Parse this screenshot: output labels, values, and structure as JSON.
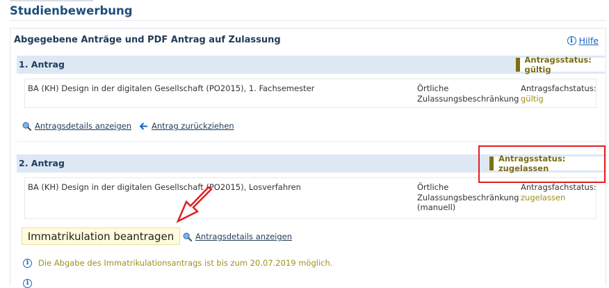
{
  "page": {
    "title": "Studienbewerbung"
  },
  "panel": {
    "title": "Abgegebene Anträge und PDF Antrag auf Zulassung",
    "help_label": "Hilfe"
  },
  "applications": [
    {
      "header": "1. Antrag",
      "status": "Antragsstatus: gültig",
      "course": "BA (KH) Design in der digitalen Gesellschaft (PO2015), 1. Fachsemester",
      "zulassung_line1": "Örtliche",
      "zulassung_line2": "Zulassungsbeschränkung",
      "fach_label": "Antragsfachstatus:",
      "fach_value": "gültig",
      "link_details": "Antragsdetails anzeigen",
      "link_withdraw": "Antrag zurückziehen"
    },
    {
      "header": "2. Antrag",
      "status": "Antragsstatus: zugelassen",
      "course": "BA (KH) Design in der digitalen Gesellschaft (PO2015), Losverfahren",
      "zulassung_line1": "Örtliche",
      "zulassung_line2": "Zulassungsbeschränkung",
      "zulassung_line3": "(manuell)",
      "fach_label": "Antragsfachstatus:",
      "fach_value": "zugelassen",
      "immat_button": "Immatrikulation beantragen",
      "link_details": "Antragsdetails anzeigen",
      "notice": "Die Abgabe des Immatrikulationsantrags ist bis zum 20.07.2019 möglich."
    }
  ],
  "colors": {
    "header_bg": "#dde8f4",
    "status_accent": "#7d7010",
    "highlight_red": "#e21d22",
    "link_blue": "#1565c0"
  },
  "icons": [
    "info-icon",
    "magnifier-icon",
    "arrow-left-icon",
    "red-arrow-annotation"
  ]
}
